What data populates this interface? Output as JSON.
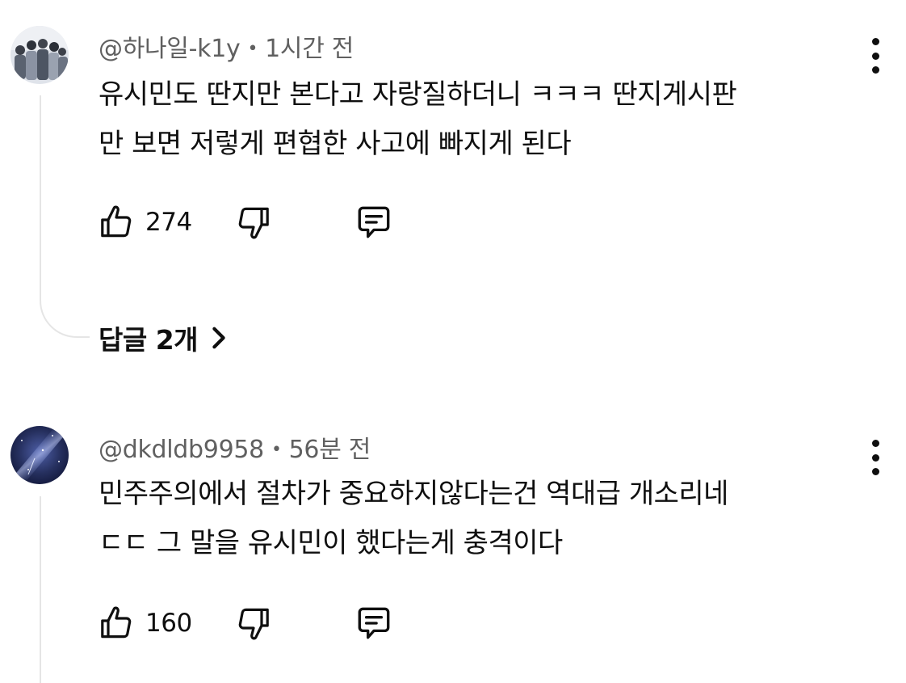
{
  "comments": [
    {
      "author": "@하나일-k1y",
      "time": "1시간 전",
      "lines": [
        "유시민도 딴지만 본다고 자랑질하더니 ㅋㅋㅋ 딴지게시판",
        "만 보면 저렇게 편협한 사고에 빠지게 된다"
      ],
      "likes": "274",
      "replies_label": "답글 2개"
    },
    {
      "author": "@dkdldb9958",
      "time": "56분 전",
      "lines": [
        "민주주의에서 절차가 중요하지않다는건 역대급 개소리네",
        "ㄷㄷ  그 말을 유시민이 했다는게 충격이다"
      ],
      "likes": "160"
    }
  ],
  "icons": {
    "like": "thumbs-up-icon",
    "dislike": "thumbs-down-icon",
    "reply": "comment-icon",
    "more": "more-vertical-icon",
    "chevron": "chevron-right-icon"
  },
  "colors": {
    "text": "#0f0f0f",
    "meta": "#606060",
    "thread": "#e5e5e5"
  }
}
